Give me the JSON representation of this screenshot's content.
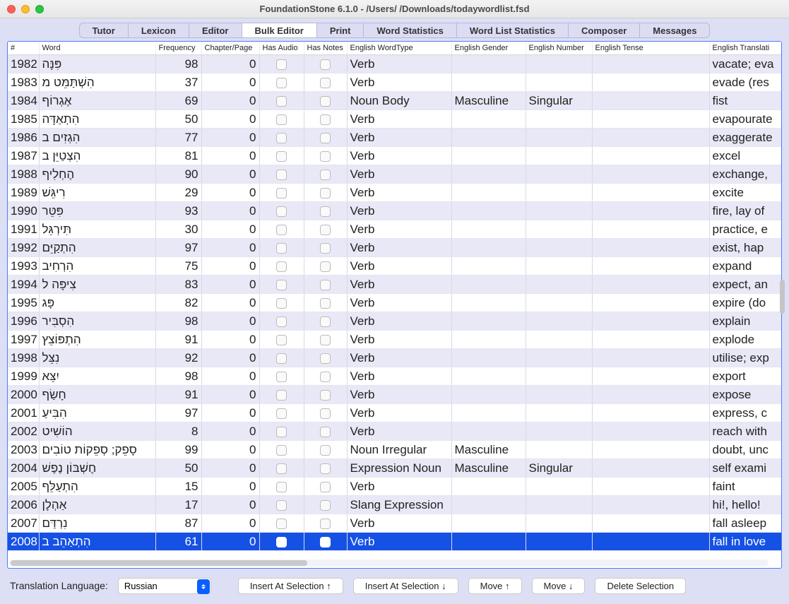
{
  "window": {
    "title": "FoundationStone 6.1.0 - /Users/        /Downloads/todaywordlist.fsd"
  },
  "tabs": [
    {
      "label": "Tutor"
    },
    {
      "label": "Lexicon"
    },
    {
      "label": "Editor"
    },
    {
      "label": "Bulk Editor",
      "active": true
    },
    {
      "label": "Print"
    },
    {
      "label": "Word Statistics"
    },
    {
      "label": "Word List Statistics"
    },
    {
      "label": "Composer"
    },
    {
      "label": "Messages"
    }
  ],
  "columns": {
    "num": "#",
    "word": "Word",
    "freq": "Frequency",
    "chap": "Chapter/Page",
    "audio": "Has Audio",
    "notes": "Has Notes",
    "type": "English WordType",
    "gender": "English Gender",
    "number": "English Number",
    "tense": "English Tense",
    "trans": "English Translati"
  },
  "rows": [
    {
      "n": "1982",
      "w": "פִּנָּה",
      "f": "98",
      "c": "0",
      "t": "Verb",
      "g": "",
      "num": "",
      "tr": "vacate; eva"
    },
    {
      "n": "1983",
      "w": "הִשְׁתַּמֵּט מ",
      "f": "37",
      "c": "0",
      "t": "Verb",
      "g": "",
      "num": "",
      "tr": "evade (res"
    },
    {
      "n": "1984",
      "w": "אֶגְרוֹף",
      "f": "69",
      "c": "0",
      "t": "Noun Body",
      "g": "Masculine",
      "num": "Singular",
      "tr": "fist"
    },
    {
      "n": "1985",
      "w": "הִתְאַדָּה",
      "f": "50",
      "c": "0",
      "t": "Verb",
      "g": "",
      "num": "",
      "tr": "evapourate"
    },
    {
      "n": "1986",
      "w": "הִגְזִים ב",
      "f": "77",
      "c": "0",
      "t": "Verb",
      "g": "",
      "num": "",
      "tr": "exaggerate"
    },
    {
      "n": "1987",
      "w": "הִצְטַיֵּן ב",
      "f": "81",
      "c": "0",
      "t": "Verb",
      "g": "",
      "num": "",
      "tr": "excel"
    },
    {
      "n": "1988",
      "w": "הֶחְלִיף",
      "f": "90",
      "c": "0",
      "t": "Verb",
      "g": "",
      "num": "",
      "tr": "exchange,"
    },
    {
      "n": "1989",
      "w": "רִיגֵּשׁ",
      "f": "29",
      "c": "0",
      "t": "Verb",
      "g": "",
      "num": "",
      "tr": "excite"
    },
    {
      "n": "1990",
      "w": "פִּטֵּר",
      "f": "93",
      "c": "0",
      "t": "Verb",
      "g": "",
      "num": "",
      "tr": "fire, lay of"
    },
    {
      "n": "1991",
      "w": "תִּירְגֵּל",
      "f": "30",
      "c": "0",
      "t": "Verb",
      "g": "",
      "num": "",
      "tr": "practice, e"
    },
    {
      "n": "1992",
      "w": "הִתְקַיֵּם",
      "f": "97",
      "c": "0",
      "t": "Verb",
      "g": "",
      "num": "",
      "tr": "exist, hap"
    },
    {
      "n": "1993",
      "w": "הִרְחִיב",
      "f": "75",
      "c": "0",
      "t": "Verb",
      "g": "",
      "num": "",
      "tr": "expand"
    },
    {
      "n": "1994",
      "w": "צִיפָּה ל",
      "f": "83",
      "c": "0",
      "t": "Verb",
      "g": "",
      "num": "",
      "tr": "expect, an"
    },
    {
      "n": "1995",
      "w": "פָּג",
      "f": "82",
      "c": "0",
      "t": "Verb",
      "g": "",
      "num": "",
      "tr": "expire (do"
    },
    {
      "n": "1996",
      "w": "הִסְבִּיר",
      "f": "98",
      "c": "0",
      "t": "Verb",
      "g": "",
      "num": "",
      "tr": "explain"
    },
    {
      "n": "1997",
      "w": "הִתְפּוֹצֵץ",
      "f": "91",
      "c": "0",
      "t": "Verb",
      "g": "",
      "num": "",
      "tr": "explode"
    },
    {
      "n": "1998",
      "w": "נִצֵּל",
      "f": "92",
      "c": "0",
      "t": "Verb",
      "g": "",
      "num": "",
      "tr": "utilise; exp"
    },
    {
      "n": "1999",
      "w": "יִצֵּא",
      "f": "98",
      "c": "0",
      "t": "Verb",
      "g": "",
      "num": "",
      "tr": "export"
    },
    {
      "n": "2000",
      "w": "חָשַׂף",
      "f": "91",
      "c": "0",
      "t": "Verb",
      "g": "",
      "num": "",
      "tr": "expose"
    },
    {
      "n": "2001",
      "w": "הִבִּיעַ",
      "f": "97",
      "c": "0",
      "t": "Verb",
      "g": "",
      "num": "",
      "tr": "express, c"
    },
    {
      "n": "2002",
      "w": "הוֹשִׁיט",
      "f": "8",
      "c": "0",
      "t": "Verb",
      "g": "",
      "num": "",
      "tr": "reach with"
    },
    {
      "n": "2003",
      "w": "סָפֵק; סְפֵקוֹת טוֹבִים",
      "f": "99",
      "c": "0",
      "t": "Noun Irregular",
      "g": "Masculine",
      "num": "",
      "tr": "doubt, unc"
    },
    {
      "n": "2004",
      "w": "חֶשְׁבּוֹן נֶפֶשׁ",
      "f": "50",
      "c": "0",
      "t": "Expression Noun",
      "g": "Masculine",
      "num": "Singular",
      "tr": "self exami"
    },
    {
      "n": "2005",
      "w": "הִתְעַלֵּף",
      "f": "15",
      "c": "0",
      "t": "Verb",
      "g": "",
      "num": "",
      "tr": "faint"
    },
    {
      "n": "2006",
      "w": "אַהְלָן",
      "f": "17",
      "c": "0",
      "t": "Slang Expression",
      "g": "",
      "num": "",
      "tr": "hi!, hello!"
    },
    {
      "n": "2007",
      "w": "נִרְדַּם",
      "f": "87",
      "c": "0",
      "t": "Verb",
      "g": "",
      "num": "",
      "tr": "fall asleep"
    },
    {
      "n": "2008",
      "w": "הִתְאַהֵב ב",
      "f": "61",
      "c": "0",
      "t": "Verb",
      "g": "",
      "num": "",
      "tr": "fall in love",
      "sel": true
    }
  ],
  "bottom": {
    "label": "Translation Language:",
    "lang": "Russian",
    "b1": "Insert At Selection ↑",
    "b2": "Insert At Selection ↓",
    "b3": "Move ↑",
    "b4": "Move ↓",
    "b5": "Delete Selection"
  }
}
